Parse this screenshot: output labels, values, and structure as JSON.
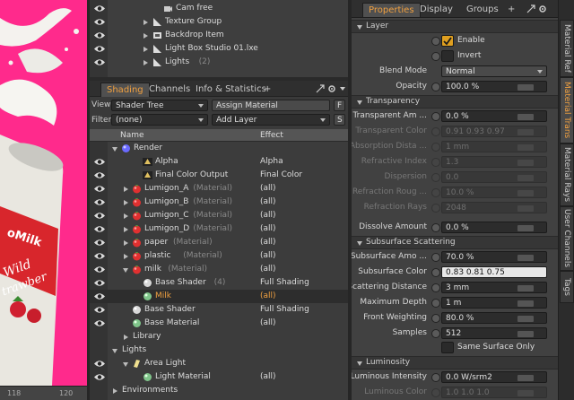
{
  "viewport": {
    "ruler_ticks": [
      "118",
      "120"
    ]
  },
  "items_list": [
    {
      "label": "Cam free",
      "icon": "camera-icon",
      "indent": 2
    },
    {
      "label": "Texture Group",
      "icon": "group-icon",
      "indent": 1
    },
    {
      "label": "Backdrop Item",
      "icon": "mesh-icon",
      "indent": 1
    },
    {
      "label": "Light Box Studio 01.lxe",
      "icon": "group-icon",
      "indent": 1
    },
    {
      "label": "Lights",
      "suffix": "(2)",
      "icon": "group-icon",
      "indent": 1
    }
  ],
  "shading_tabs": [
    "Shading",
    "Channels",
    "Info & Statistics",
    "+"
  ],
  "shading_toolbar": {
    "view_label": "View",
    "view_value": "Shader Tree",
    "assign_material": "Assign Material",
    "f_button": "F",
    "filter_label": "Filter",
    "filter_value": "(none)",
    "add_layer": "Add Layer",
    "s_button": "S"
  },
  "tree_header": {
    "name": "Name",
    "effect": "Effect"
  },
  "tree_rows": [
    {
      "label": "Render",
      "suffix": "",
      "effect": "",
      "icon": "render-icon",
      "indent": 0,
      "arrow": "down",
      "eye": false
    },
    {
      "label": "Alpha",
      "suffix": "",
      "effect": "Alpha",
      "icon": "alpha-icon",
      "indent": 2,
      "arrow": "",
      "eye": true
    },
    {
      "label": "Final Color Output",
      "suffix": "",
      "effect": "Final Color",
      "icon": "output-icon",
      "indent": 2,
      "arrow": "",
      "eye": true
    },
    {
      "label": "Lumigon_A",
      "suffix": "(Material)",
      "effect": "(all)",
      "icon": "material-icon",
      "indent": 1,
      "arrow": "right",
      "eye": true
    },
    {
      "label": "Lumigon_B",
      "suffix": "(Material)",
      "effect": "(all)",
      "icon": "material-icon",
      "indent": 1,
      "arrow": "right",
      "eye": true
    },
    {
      "label": "Lumigon_C",
      "suffix": "(Material)",
      "effect": "(all)",
      "icon": "material-icon",
      "indent": 1,
      "arrow": "right",
      "eye": true
    },
    {
      "label": "Lumigon_D",
      "suffix": "(Material)",
      "effect": "(all)",
      "icon": "material-icon",
      "indent": 1,
      "arrow": "right",
      "eye": true
    },
    {
      "label": "paper",
      "suffix": "(Material)",
      "effect": "(all)",
      "icon": "material-icon",
      "indent": 1,
      "arrow": "right",
      "eye": true
    },
    {
      "label": "plastic",
      "suffix": "(Material)",
      "effect": "(all)",
      "icon": "material-icon",
      "indent": 1,
      "arrow": "right",
      "eye": true
    },
    {
      "label": "milk",
      "suffix": "(Material)",
      "effect": "(all)",
      "icon": "material-icon",
      "indent": 1,
      "arrow": "down",
      "eye": true
    },
    {
      "label": "Base Shader",
      "suffix": "(4)",
      "effect": "Full Shading",
      "icon": "shader-icon",
      "indent": 2,
      "arrow": "",
      "eye": true
    },
    {
      "label": "Milk",
      "suffix": "",
      "effect": "(all)",
      "icon": "base-material-icon",
      "indent": 2,
      "arrow": "",
      "eye": true,
      "selected": true
    },
    {
      "label": "Base Shader",
      "suffix": "",
      "effect": "Full Shading",
      "icon": "shader-icon",
      "indent": 1,
      "arrow": "",
      "eye": true
    },
    {
      "label": "Base Material",
      "suffix": "",
      "effect": "(all)",
      "icon": "base-material-icon",
      "indent": 1,
      "arrow": "",
      "eye": true
    },
    {
      "label": "Library",
      "suffix": "",
      "effect": "",
      "icon": "",
      "indent": 1,
      "arrow": "right",
      "eye": false
    },
    {
      "label": "Lights",
      "suffix": "",
      "effect": "",
      "icon": "",
      "indent": 0,
      "arrow": "down",
      "eye": false
    },
    {
      "label": "Area Light",
      "suffix": "",
      "effect": "",
      "icon": "light-icon",
      "indent": 1,
      "arrow": "down",
      "eye": true
    },
    {
      "label": "Light Material",
      "suffix": "",
      "effect": "(all)",
      "icon": "light-material-icon",
      "indent": 2,
      "arrow": "",
      "eye": true
    },
    {
      "label": "Environments",
      "suffix": "",
      "effect": "",
      "icon": "",
      "indent": 0,
      "arrow": "right",
      "eye": false
    }
  ],
  "props_tabs": [
    "Properties",
    "Display",
    "Groups",
    "+"
  ],
  "sections": {
    "layer": "Layer",
    "transparency": "Transparency",
    "subsurface": "Subsurface Scattering",
    "luminosity": "Luminosity"
  },
  "layer": {
    "enable": "Enable",
    "invert": "Invert",
    "blend_mode_label": "Blend Mode",
    "blend_mode_value": "Normal",
    "opacity_label": "Opacity",
    "opacity_value": "100.0 %"
  },
  "transparency": [
    {
      "label": "Transparent Am ...",
      "value": "0.0 %",
      "disabled": false
    },
    {
      "label": "Transparent Color",
      "value": "0.91    0.93    0.97",
      "disabled": true
    },
    {
      "label": "Absorption Dista ...",
      "value": "1 mm",
      "disabled": true
    },
    {
      "label": "Refractive Index",
      "value": "1.3",
      "disabled": true
    },
    {
      "label": "Dispersion",
      "value": "0.0",
      "disabled": true
    },
    {
      "label": "Refraction Roug ...",
      "value": "10.0 %",
      "disabled": true
    },
    {
      "label": "Refraction Rays",
      "value": "2048",
      "disabled": true
    }
  ],
  "dissolve": {
    "label": "Dissolve Amount",
    "value": "0.0 %"
  },
  "subsurface": [
    {
      "label": "Subsurface Amo ...",
      "value": "70.0 %"
    },
    {
      "label": "Subsurface Color",
      "value": "0.83    0.81    0.75",
      "light": true
    },
    {
      "label": "Scattering Distance",
      "value": "3 mm"
    },
    {
      "label": "Maximum Depth",
      "value": "1 m"
    },
    {
      "label": "Front Weighting",
      "value": "80.0 %"
    },
    {
      "label": "Samples",
      "value": "512"
    }
  ],
  "same_surface_only": "Same Surface Only",
  "luminosity": [
    {
      "label": "Luminous Intensity",
      "value": "0.0 W/srm2",
      "disabled": false
    },
    {
      "label": "Luminous Color",
      "value": "1.0    1.0    1.0",
      "disabled": true
    }
  ],
  "vertical_tabs": [
    "Material Ref",
    "Material Trans",
    "Material Rays",
    "User Channels",
    "Tags"
  ],
  "colors": {
    "accent": "#f0a040",
    "viewport_bg": "#ff2a8c",
    "panel_bg": "#414141"
  }
}
